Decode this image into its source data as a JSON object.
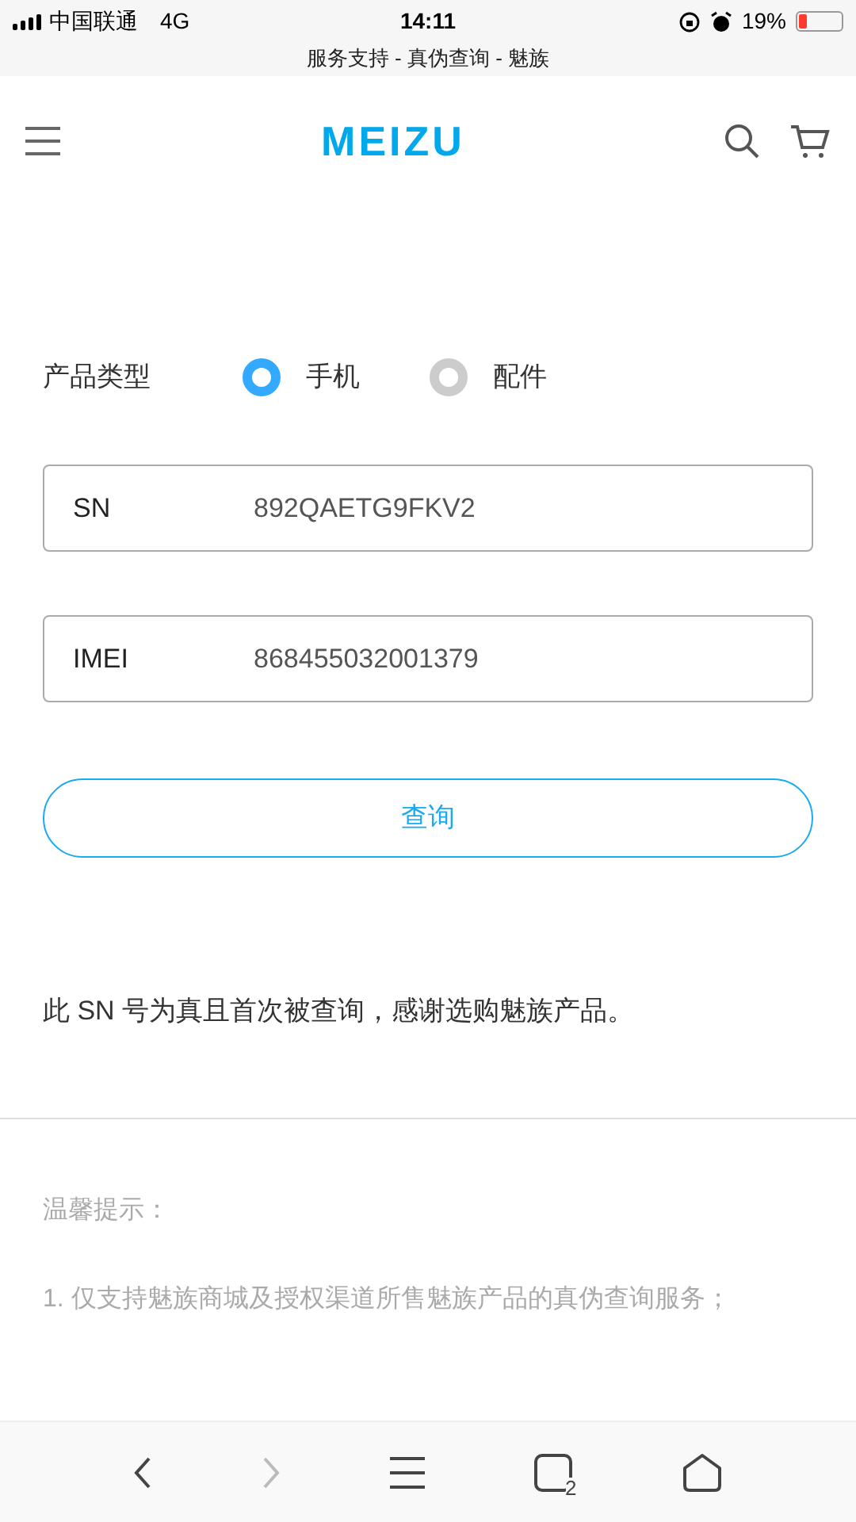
{
  "status_bar": {
    "carrier": "中国联通",
    "network": "4G",
    "time": "14:11",
    "battery": "19%"
  },
  "page_title": "服务支持 - 真伪查询 - 魅族",
  "header": {
    "logo": "MEIZU"
  },
  "product_type": {
    "label": "产品类型",
    "options": [
      {
        "label": "手机",
        "selected": true
      },
      {
        "label": "配件",
        "selected": false
      }
    ]
  },
  "fields": [
    {
      "label": "SN",
      "value": "892QAETG9FKV2"
    },
    {
      "label": "IMEI",
      "value": "868455032001379"
    }
  ],
  "query_button": "查询",
  "result": "此 SN 号为真且首次被查询，感谢选购魅族产品。",
  "tips": {
    "title": "温馨提示：",
    "items": [
      "1. 仅支持魅族商城及授权渠道所售魅族产品的真伪查询服务；"
    ]
  },
  "browser_bar": {
    "forward_disabled": true,
    "tab_count": "2"
  }
}
